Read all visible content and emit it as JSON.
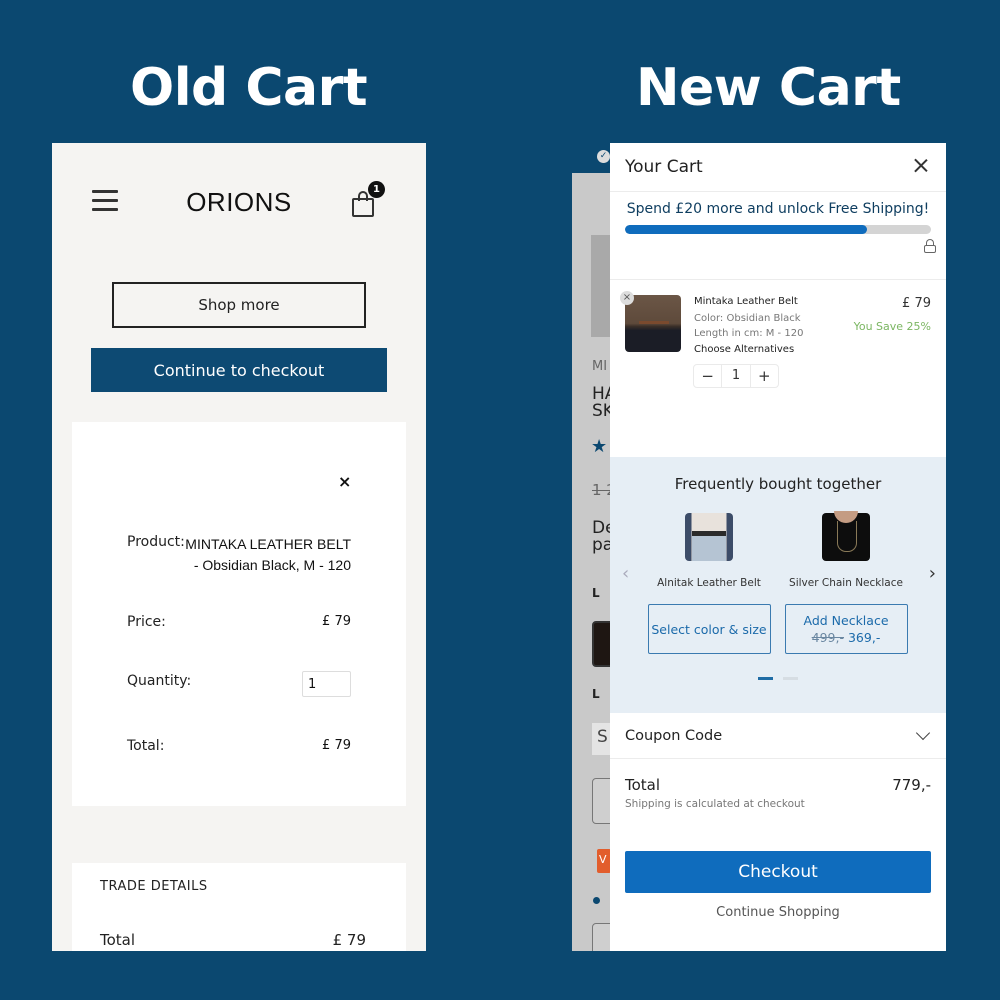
{
  "headings": {
    "old": "Old Cart",
    "new": "New Cart"
  },
  "old_cart": {
    "logo": "ORIONS",
    "cart_badge_count": "1",
    "shop_more_label": "Shop more",
    "continue_checkout_label": "Continue to checkout",
    "close_glyph": "×",
    "product_label": "Product:",
    "product_value": "MINTAKA LEATHER BELT - Obsidian Black, M - 120",
    "price_label": "Price:",
    "price_value": "£ 79",
    "quantity_label": "Quantity:",
    "quantity_value": "1",
    "total_label": "Total:",
    "total_value": "£ 79",
    "trade_details_title": "TRADE DETAILS",
    "trade_total_label": "Total",
    "trade_total_value": "£ 79"
  },
  "new_cart": {
    "background_page": {
      "brand_abbrev": "MI",
      "title_lines": [
        "HA",
        "SK"
      ],
      "old_price_fragment": "1 2",
      "desc_lines": [
        "De",
        "pa"
      ],
      "label_1": "L",
      "label_2": "L",
      "select_fragment": "S",
      "badge_fragment": "V"
    },
    "title": "Your Cart",
    "shipping_message": "Spend £20 more and unlock Free Shipping!",
    "shipping_progress_percent": 79,
    "item": {
      "name": "Mintaka Leather Belt",
      "color": "Color: Obsidian Black",
      "length": "Length in cm: M - 120",
      "choose_alternatives": "Choose Alternatives",
      "price": "£ 79",
      "savings": "You Save 25%",
      "quantity": "1",
      "minus": "−",
      "plus": "+",
      "remove_glyph": "×"
    },
    "fbt": {
      "title": "Frequently bought together",
      "items": [
        {
          "name": "Alnitak Leather Belt",
          "button_label": "Select color & size"
        },
        {
          "name": "Silver Chain Necklace",
          "button_label": "Add Necklace",
          "old_price": "499,-",
          "new_price": "369,-"
        }
      ],
      "prev_arrow": "‹",
      "next_arrow": "›",
      "active_page": 1,
      "page_count": 2
    },
    "coupon_label": "Coupon Code",
    "total_label": "Total",
    "total_value": "779,-",
    "shipping_note": "Shipping is calculated at checkout",
    "checkout_label": "Checkout",
    "continue_shopping_label": "Continue Shopping"
  },
  "colors": {
    "page_background": "#0b4870",
    "old_primary": "#0d4a73",
    "new_primary": "#0f6cbd",
    "savings_green": "#7bb662"
  }
}
